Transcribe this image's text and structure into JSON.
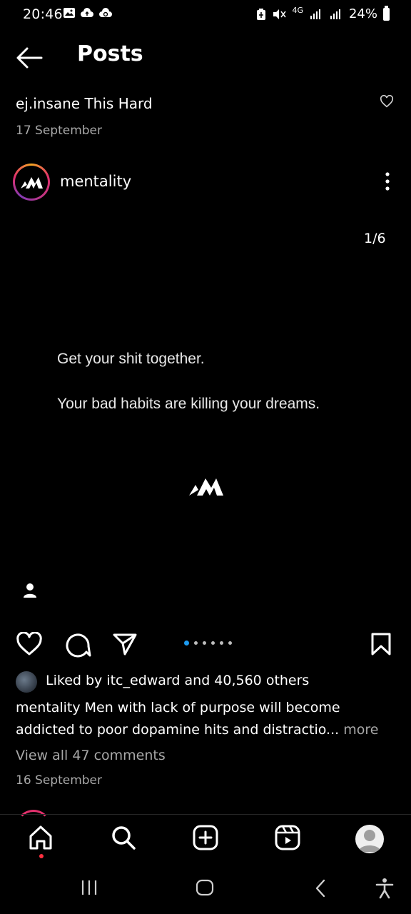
{
  "status_bar": {
    "time": "20:46",
    "network": "4G",
    "battery": "24%"
  },
  "header": {
    "title": "Posts"
  },
  "previous_post": {
    "caption": "ej.insane This Hard",
    "date": "17 September"
  },
  "post": {
    "username": "mentality",
    "page_counter": "1/6",
    "image_text_line1": "Get your shit together.",
    "image_text_line2": "Your bad habits are killing your dreams.",
    "carousel": {
      "total": 6,
      "active": 1
    },
    "liked_by": "Liked by itc_edward and 40,560 others",
    "caption_line1": "mentality Men with lack of purpose will become",
    "caption_line2": "addicted to poor dopamine hits and distractio...",
    "caption_more": "more",
    "view_comments": "View all 47 comments",
    "date": "16 September"
  },
  "colors": {
    "background": "#000000",
    "secondary_text": "#a8a8a8",
    "active_dot": "#1d9bf0",
    "notification": "#ff3040"
  },
  "icons": [
    "back-arrow-icon",
    "heart-icon",
    "more-vertical-icon",
    "comment-icon",
    "share-icon",
    "bookmark-icon",
    "home-icon",
    "search-icon",
    "create-icon",
    "reels-icon",
    "profile-icon",
    "user-tag-icon"
  ]
}
